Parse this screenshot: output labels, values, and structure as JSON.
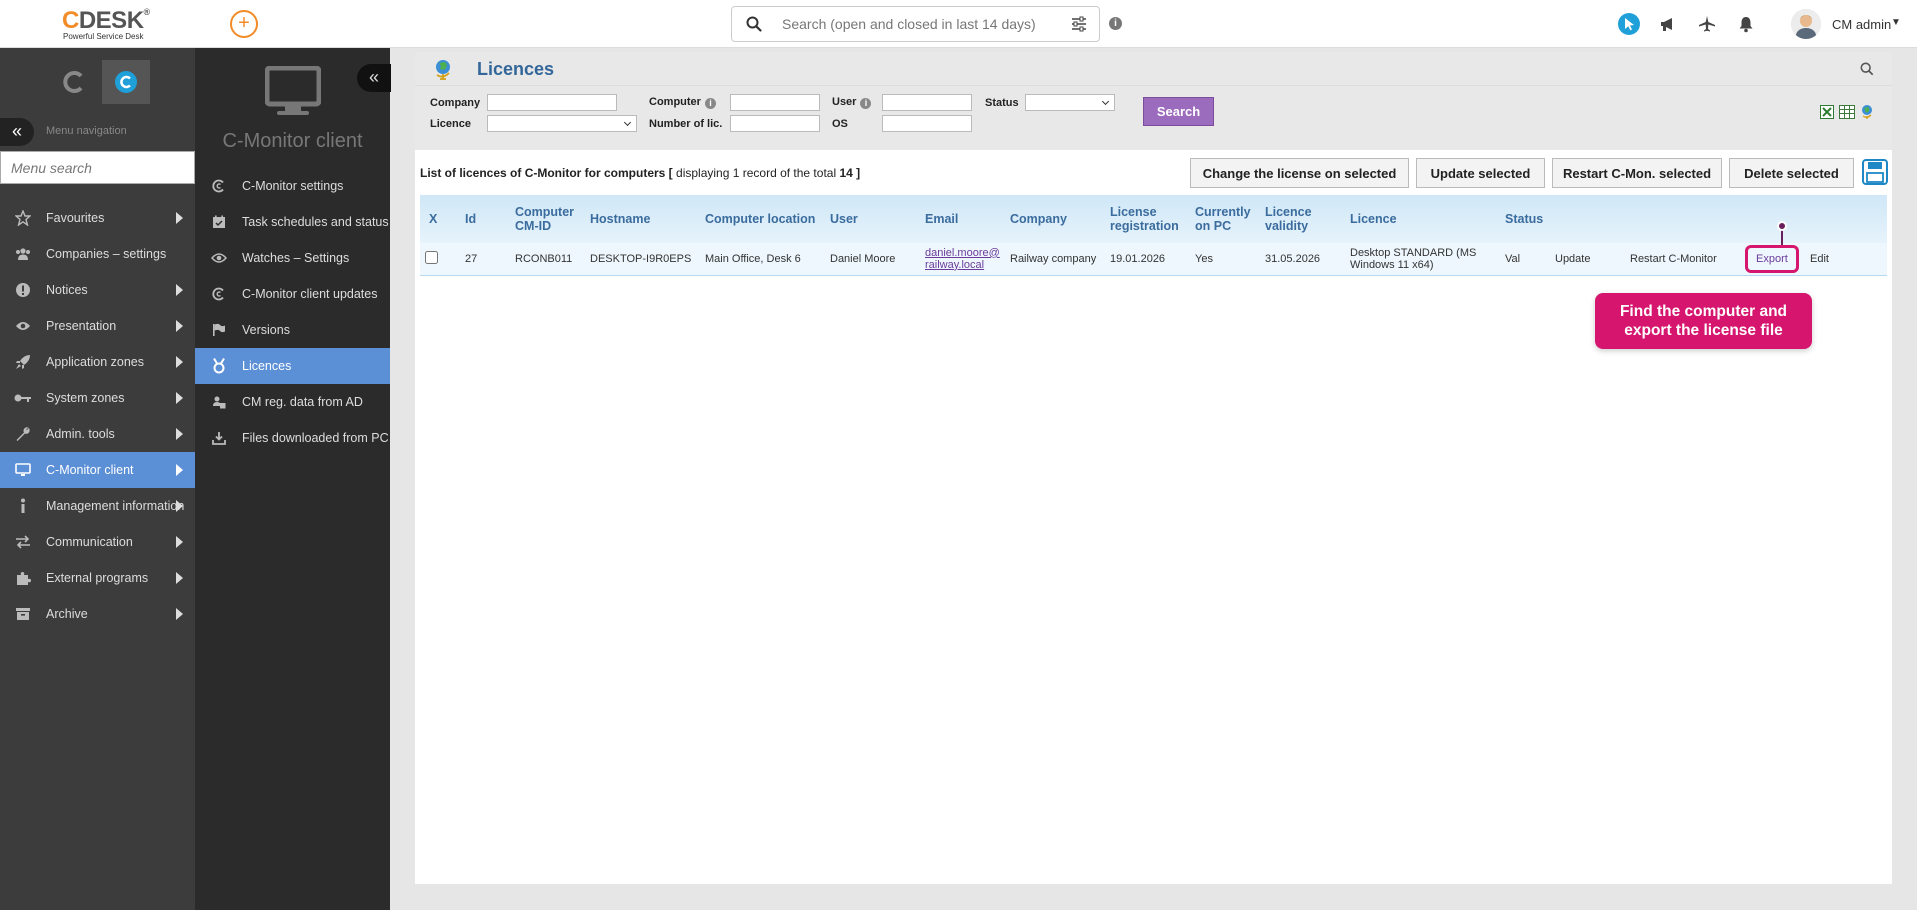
{
  "topbar": {
    "logo_main": "DESK",
    "logo_c": "C",
    "logo_reg": "®",
    "logo_sub": "Powerful Service Desk",
    "add_label": "+",
    "search_placeholder": "Search (open and closed in last 14 days)",
    "info_label": "i",
    "user_name": "CM admin"
  },
  "sidebar": {
    "nav_label": "Menu navigation",
    "collapse_label": "«",
    "search_placeholder": "Menu search",
    "items": [
      {
        "label": "Favourites",
        "icon": "star-icon",
        "arrow": true
      },
      {
        "label": "Companies – settings",
        "icon": "users-icon",
        "arrow": false
      },
      {
        "label": "Notices",
        "icon": "exclamation-icon",
        "arrow": true
      },
      {
        "label": "Presentation",
        "icon": "eye-icon",
        "arrow": true
      },
      {
        "label": "Application zones",
        "icon": "rocket-icon",
        "arrow": true
      },
      {
        "label": "System zones",
        "icon": "key-icon",
        "arrow": true
      },
      {
        "label": "Admin. tools",
        "icon": "wrench-icon",
        "arrow": true
      },
      {
        "label": "C-Monitor client",
        "icon": "monitor-icon",
        "arrow": true,
        "active": true
      },
      {
        "label": "Management information",
        "icon": "info-icon",
        "arrow": true
      },
      {
        "label": "Communication",
        "icon": "exchange-icon",
        "arrow": true
      },
      {
        "label": "External programs",
        "icon": "puzzle-icon",
        "arrow": true
      },
      {
        "label": "Archive",
        "icon": "archive-icon",
        "arrow": true
      }
    ]
  },
  "subbar": {
    "collapse_label": "«",
    "title": "C-Monitor client",
    "items": [
      {
        "label": "C-Monitor settings"
      },
      {
        "label": "Task schedules and status"
      },
      {
        "label": "Watches – Settings"
      },
      {
        "label": "C-Monitor client updates"
      },
      {
        "label": "Versions"
      },
      {
        "label": "Licences",
        "active": true
      },
      {
        "label": "CM reg. data from AD"
      },
      {
        "label": "Files downloaded from PC"
      }
    ]
  },
  "page": {
    "title": "Licences",
    "filters": {
      "company_label": "Company",
      "computer_label": "Computer",
      "user_label": "User",
      "status_label": "Status",
      "licence_label": "Licence",
      "number_label": "Number of lic.",
      "os_label": "OS",
      "info_glyph": "i",
      "search_button": "Search"
    },
    "list_caption_bold": "List of licences of C-Monitor for computers [",
    "list_caption_text": " displaying 1 record of the total ",
    "list_caption_total": "14",
    "list_caption_end": " ]",
    "buttons": {
      "change_license": "Change the license on selected",
      "update_selected": "Update selected",
      "restart_selected": "Restart C-Mon. selected",
      "delete_selected": "Delete selected"
    },
    "table": {
      "headers": {
        "x": "X",
        "id": "Id",
        "cmid": "Computer CM-ID",
        "hostname": "Hostname",
        "location": "Computer location",
        "user": "User",
        "email": "Email",
        "company": "Company",
        "registration": "License registration",
        "on_pc": "Currently on PC",
        "validity": "Licence validity",
        "licence": "Licence",
        "status": "Status"
      },
      "rows": [
        {
          "id": "27",
          "cmid": "RCONB011",
          "hostname": "DESKTOP-I9R0EPS",
          "location": "Main Office, Desk 6",
          "user": "Daniel Moore",
          "email": "daniel.moore@ railway.local",
          "company": "Railway company",
          "registration": "19.01.2026",
          "on_pc": "Yes",
          "validity": "31.05.2026",
          "licence": "Desktop STANDARD (MS Windows 11 x64)",
          "status": "Val",
          "update": "Update",
          "restart": "Restart C-Monitor",
          "export": "Export",
          "edit": "Edit"
        }
      ]
    },
    "callout": "Find the computer and export the license file"
  },
  "colors": {
    "accent": "#5b8fd6",
    "callout": "#d6166e",
    "search_button": "#9b6bbd",
    "brand_orange": "#f28c28"
  }
}
